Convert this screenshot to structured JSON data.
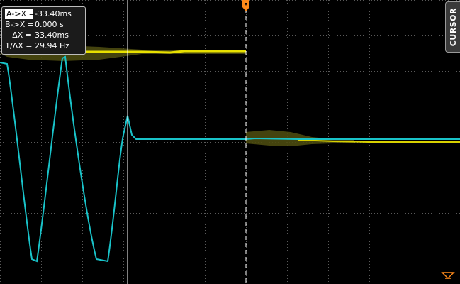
{
  "readout": {
    "rows": [
      {
        "label": "A->X =",
        "value": "-33.40ms"
      },
      {
        "label": "B->X =",
        "value": "0.000 s"
      },
      {
        "label": "ΔX =",
        "value": "33.40ms"
      },
      {
        "label": "1/ΔX =",
        "value": "29.94 Hz"
      }
    ]
  },
  "side_tab": {
    "label": "CURSOR"
  },
  "colors": {
    "channel1": "#e8e000",
    "channel2": "#19c3c9",
    "trigger_marker": "#ff8a1a",
    "grid": "#5a5a5a",
    "cursor_line": "#ffffff"
  },
  "icons": [
    "trigger-position-marker-icon",
    "trigger-level-marker-icon"
  ]
}
